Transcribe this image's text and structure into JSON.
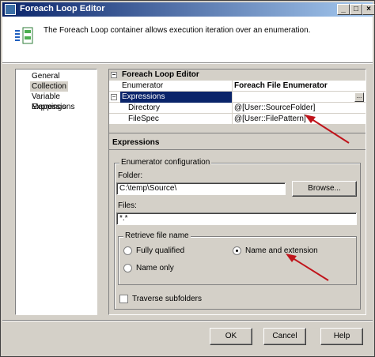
{
  "window": {
    "title": "Foreach Loop Editor"
  },
  "header": {
    "description": "The Foreach Loop container allows execution iteration over an enumeration."
  },
  "nav": {
    "items": [
      "General",
      "Collection",
      "Variable Mappings",
      "Expressions"
    ],
    "selected": "Collection"
  },
  "grid": {
    "category": "Foreach Loop Editor",
    "enumerator_label": "Enumerator",
    "enumerator_value": "Foreach File Enumerator",
    "expressions_label": "Expressions",
    "rows": [
      {
        "name": "Directory",
        "value": "@[User::SourceFolder]"
      },
      {
        "name": "FileSpec",
        "value": "@[User::FilePattern]"
      }
    ],
    "ellipsis": "..."
  },
  "description_panel": {
    "title": "Expressions"
  },
  "enumerator_config": {
    "legend": "Enumerator configuration",
    "folder_label": "Folder:",
    "folder_value": "C:\\temp\\Source\\",
    "browse_label": "Browse...",
    "files_label": "Files:",
    "files_value": "*.*",
    "retrieve": {
      "legend": "Retrieve file name",
      "options": [
        "Fully qualified",
        "Name and extension",
        "Name only"
      ],
      "selected": "Name and extension"
    },
    "traverse_label": "Traverse subfolders"
  },
  "buttons": {
    "ok": "OK",
    "cancel": "Cancel",
    "help": "Help"
  },
  "colors": {
    "title_start": "#0a246a",
    "title_end": "#a6caf0",
    "arrow": "#c0141b",
    "selection": "#0a246a"
  }
}
